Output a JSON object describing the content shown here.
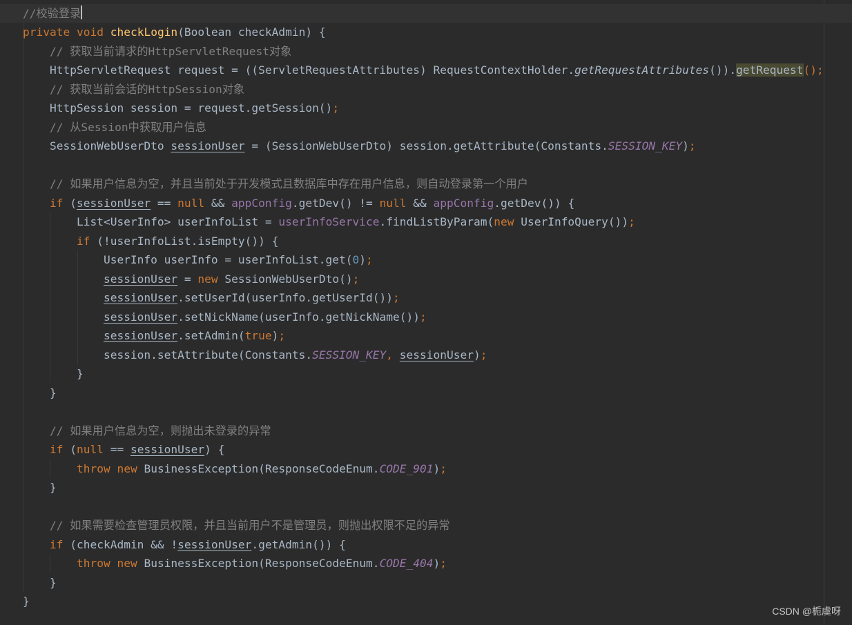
{
  "editor": {
    "lines": [
      [
        {
          "t": "//校验登录",
          "c": "cm"
        }
      ],
      [
        {
          "t": "private",
          "c": "kw"
        },
        {
          "t": " "
        },
        {
          "t": "void",
          "c": "kw"
        },
        {
          "t": " "
        },
        {
          "t": "checkLogin",
          "c": "fn"
        },
        {
          "t": "(Boolean checkAdmin) {"
        }
      ],
      [
        {
          "t": "    "
        },
        {
          "t": "// 获取当前请求的HttpServletRequest对象",
          "c": "cm"
        }
      ],
      [
        {
          "t": "    HttpServletRequest request = ((ServletRequestAttributes) RequestContextHolder."
        },
        {
          "t": "getRequestAttributes",
          "c": "static"
        },
        {
          "t": "())."
        },
        {
          "t": "getRequest",
          "c": "hl"
        },
        {
          "t": "();",
          "c": "kw"
        }
      ],
      [
        {
          "t": "    "
        },
        {
          "t": "// 获取当前会话的HttpSession对象",
          "c": "cm"
        }
      ],
      [
        {
          "t": "    HttpSession session = request.getSession()"
        },
        {
          "t": ";",
          "c": "kw"
        }
      ],
      [
        {
          "t": "    "
        },
        {
          "t": "// 从Session中获取用户信息",
          "c": "cm"
        }
      ],
      [
        {
          "t": "    SessionWebUserDto "
        },
        {
          "t": "sessionUser",
          "c": "under"
        },
        {
          "t": " = (SessionWebUserDto) session.getAttribute(Constants."
        },
        {
          "t": "SESSION_KEY",
          "c": "const"
        },
        {
          "t": ")"
        },
        {
          "t": ";",
          "c": "kw"
        }
      ],
      [],
      [
        {
          "t": "    "
        },
        {
          "t": "// 如果用户信息为空，并且当前处于开发模式且数据库中存在用户信息，则自动登录第一个用户",
          "c": "cm"
        }
      ],
      [
        {
          "t": "    "
        },
        {
          "t": "if",
          "c": "kw"
        },
        {
          "t": " ("
        },
        {
          "t": "sessionUser",
          "c": "under"
        },
        {
          "t": " == "
        },
        {
          "t": "null",
          "c": "kw"
        },
        {
          "t": " && "
        },
        {
          "t": "appConfig",
          "c": "field"
        },
        {
          "t": ".getDev() != "
        },
        {
          "t": "null",
          "c": "kw"
        },
        {
          "t": " && "
        },
        {
          "t": "appConfig",
          "c": "field"
        },
        {
          "t": ".getDev()) {"
        }
      ],
      [
        {
          "t": "        List<UserInfo> userInfoList = "
        },
        {
          "t": "userInfoService",
          "c": "field"
        },
        {
          "t": ".findListByParam("
        },
        {
          "t": "new",
          "c": "kw"
        },
        {
          "t": " UserInfoQuery())"
        },
        {
          "t": ";",
          "c": "kw"
        }
      ],
      [
        {
          "t": "        "
        },
        {
          "t": "if",
          "c": "kw"
        },
        {
          "t": " (!userInfoList.isEmpty()) {"
        }
      ],
      [
        {
          "t": "            UserInfo userInfo = userInfoList.get("
        },
        {
          "t": "0",
          "c": "num"
        },
        {
          "t": ")"
        },
        {
          "t": ";",
          "c": "kw"
        }
      ],
      [
        {
          "t": "            "
        },
        {
          "t": "sessionUser",
          "c": "under"
        },
        {
          "t": " = "
        },
        {
          "t": "new",
          "c": "kw"
        },
        {
          "t": " SessionWebUserDto()"
        },
        {
          "t": ";",
          "c": "kw"
        }
      ],
      [
        {
          "t": "            "
        },
        {
          "t": "sessionUser",
          "c": "under"
        },
        {
          "t": ".setUserId(userInfo.getUserId())"
        },
        {
          "t": ";",
          "c": "kw"
        }
      ],
      [
        {
          "t": "            "
        },
        {
          "t": "sessionUser",
          "c": "under"
        },
        {
          "t": ".setNickName(userInfo.getNickName())"
        },
        {
          "t": ";",
          "c": "kw"
        }
      ],
      [
        {
          "t": "            "
        },
        {
          "t": "sessionUser",
          "c": "under"
        },
        {
          "t": ".setAdmin("
        },
        {
          "t": "true",
          "c": "kw"
        },
        {
          "t": ")"
        },
        {
          "t": ";",
          "c": "kw"
        }
      ],
      [
        {
          "t": "            session.setAttribute(Constants."
        },
        {
          "t": "SESSION_KEY",
          "c": "const"
        },
        {
          "t": ", ",
          "c": "kw"
        },
        {
          "t": "sessionUser",
          "c": "under"
        },
        {
          "t": ")"
        },
        {
          "t": ";",
          "c": "kw"
        }
      ],
      [
        {
          "t": "        }"
        }
      ],
      [
        {
          "t": "    }"
        }
      ],
      [],
      [
        {
          "t": "    "
        },
        {
          "t": "// 如果用户信息为空，则抛出未登录的异常",
          "c": "cm"
        }
      ],
      [
        {
          "t": "    "
        },
        {
          "t": "if",
          "c": "kw"
        },
        {
          "t": " ("
        },
        {
          "t": "null",
          "c": "kw"
        },
        {
          "t": " == "
        },
        {
          "t": "sessionUser",
          "c": "under"
        },
        {
          "t": ") {"
        }
      ],
      [
        {
          "t": "        "
        },
        {
          "t": "throw",
          "c": "kw"
        },
        {
          "t": " "
        },
        {
          "t": "new",
          "c": "kw"
        },
        {
          "t": " BusinessException(ResponseCodeEnum."
        },
        {
          "t": "CODE_901",
          "c": "const"
        },
        {
          "t": ")"
        },
        {
          "t": ";",
          "c": "kw"
        }
      ],
      [
        {
          "t": "    }"
        }
      ],
      [],
      [
        {
          "t": "    "
        },
        {
          "t": "// 如果需要检查管理员权限，并且当前用户不是管理员，则抛出权限不足的异常",
          "c": "cm"
        }
      ],
      [
        {
          "t": "    "
        },
        {
          "t": "if",
          "c": "kw"
        },
        {
          "t": " (checkAdmin && !"
        },
        {
          "t": "sessionUser",
          "c": "under"
        },
        {
          "t": ".getAdmin()) {"
        }
      ],
      [
        {
          "t": "        "
        },
        {
          "t": "throw",
          "c": "kw"
        },
        {
          "t": " "
        },
        {
          "t": "new",
          "c": "kw"
        },
        {
          "t": " BusinessException(ResponseCodeEnum."
        },
        {
          "t": "CODE_404",
          "c": "const"
        },
        {
          "t": ")"
        },
        {
          "t": ";",
          "c": "kw"
        }
      ],
      [
        {
          "t": "    }"
        }
      ],
      [
        {
          "t": "}"
        }
      ]
    ]
  },
  "watermark": "CSDN @栀虞呀",
  "colors": {
    "background": "#2b2b2b",
    "current_line": "#323232",
    "keyword": "#cc7832",
    "method_decl": "#ffc66d",
    "comment": "#808080",
    "field": "#9876aa",
    "number": "#6897bb",
    "text": "#a9b7c6"
  }
}
